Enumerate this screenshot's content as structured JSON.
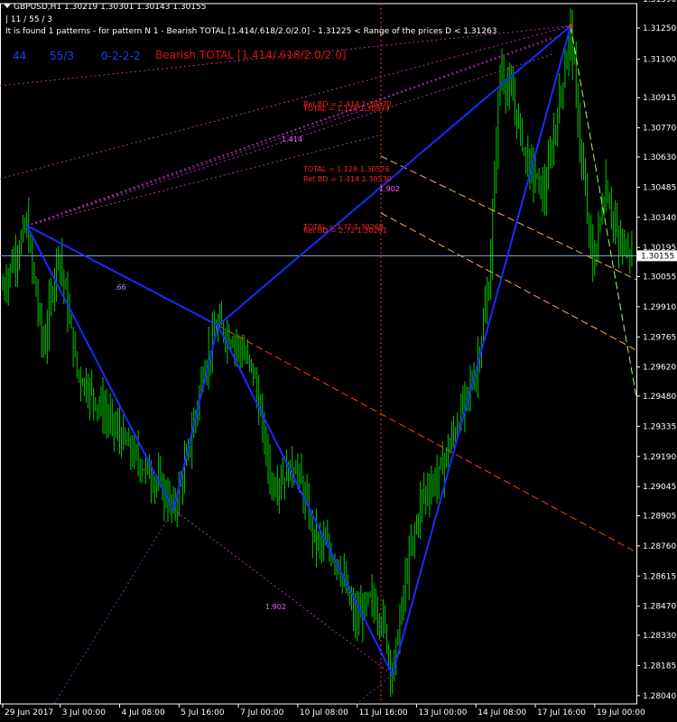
{
  "header": {
    "symbol_line": "GBPUSD,H1  1.30219 1.30301 1.30143 1.30155",
    "counter_line": "| 11 / 55 / 3",
    "info_line": "It is found 1 patterns  -  for pattern N 1 - Bearish TOTAL [1.414/.618/2.0/2.0] - 1.31225 < Range of the prices D < 1.31263"
  },
  "pattern_row": {
    "num": "44",
    "ratio": "55/3",
    "code": "0-2-2-2",
    "name": "Bearish TOTAL [1.414/.618/2.0/2.0]"
  },
  "labels": {
    "ret_bd_top": "Ret BD = 1.414  1.30870",
    "total_top": "TOTAL = 1.128  1.30879",
    "total_mid": "TOTAL = 1.128  1.30576",
    "ret_bd_mid": "Ret BD = 1.414  1.30530",
    "fib_1902_mid": "1.902",
    "total_low": "TOTAL = 1.??  1.30269",
    "ret_bd_low": "Ret BD = 2.72  1.30261",
    "fib_1414": "1.414",
    "fib_66": ".66",
    "fib_1902_low": "1.902"
  },
  "chart_data": {
    "type": "candlestick",
    "symbol": "GBPUSD",
    "timeframe": "H1",
    "last_price": "1.30155",
    "ylim": [
      1.28,
      1.3135
    ],
    "y_ticks": [
      "1.31390",
      "1.31250",
      "1.31100",
      "1.30915",
      "1.30770",
      "1.30630",
      "1.30485",
      "1.30340",
      "1.30195",
      "1.30055",
      "1.29910",
      "1.29765",
      "1.29620",
      "1.29480",
      "1.29335",
      "1.29190",
      "1.29045",
      "1.28905",
      "1.28760",
      "1.28615",
      "1.28470",
      "1.28330",
      "1.28185",
      "1.28040"
    ],
    "x_ticks": [
      "29 Jun 2017",
      "3 Jul 00:00",
      "4 Jul 08:00",
      "5 Jul 16:00",
      "7 Jul 00:00",
      "10 Jul 08:00",
      "11 Jul 16:00",
      "13 Jul 00:00",
      "14 Jul 08:00",
      "17 Jul 16:00",
      "19 Jul 00:00"
    ],
    "x_tick_index": [
      0,
      31,
      63,
      95,
      127,
      159,
      191,
      223,
      255,
      287,
      319
    ],
    "bar_count": 340,
    "pattern_points": [
      {
        "i": 13,
        "price": 1.303
      },
      {
        "i": 116,
        "price": 1.2982
      },
      {
        "i": 92,
        "price": 1.28935
      },
      {
        "i": 210,
        "price": 1.2814
      },
      {
        "i": 306,
        "price": 1.3126
      }
    ],
    "price_path": [
      [
        0,
        1.3
      ],
      [
        13,
        1.303
      ],
      [
        22,
        1.297
      ],
      [
        30,
        1.302
      ],
      [
        40,
        1.296
      ],
      [
        55,
        1.294
      ],
      [
        70,
        1.292
      ],
      [
        85,
        1.2905
      ],
      [
        92,
        1.2893
      ],
      [
        100,
        1.292
      ],
      [
        108,
        1.296
      ],
      [
        116,
        1.2982
      ],
      [
        125,
        1.2975
      ],
      [
        135,
        1.296
      ],
      [
        145,
        1.2905
      ],
      [
        158,
        1.2915
      ],
      [
        168,
        1.288
      ],
      [
        180,
        1.287
      ],
      [
        190,
        1.284
      ],
      [
        198,
        1.285
      ],
      [
        205,
        1.284
      ],
      [
        210,
        1.2814
      ],
      [
        218,
        1.2865
      ],
      [
        226,
        1.29
      ],
      [
        235,
        1.291
      ],
      [
        245,
        1.2935
      ],
      [
        255,
        1.296
      ],
      [
        262,
        1.3
      ],
      [
        268,
        1.3105
      ],
      [
        275,
        1.309
      ],
      [
        283,
        1.306
      ],
      [
        292,
        1.3045
      ],
      [
        300,
        1.309
      ],
      [
        306,
        1.3125
      ],
      [
        312,
        1.306
      ],
      [
        318,
        1.301
      ],
      [
        325,
        1.305
      ],
      [
        332,
        1.302
      ],
      [
        340,
        1.302
      ]
    ]
  },
  "colors": {
    "background": "#000000",
    "candles": "#00cc00",
    "pattern": "#1a2cff",
    "grid": "#ffffff",
    "price_line": "#8aa9d6",
    "fan": "#b030b0",
    "forecast_1": "#ff4000",
    "forecast_2": "#ffaa55",
    "forecast_3": "#aaff66",
    "text_red": "#ff2020"
  }
}
